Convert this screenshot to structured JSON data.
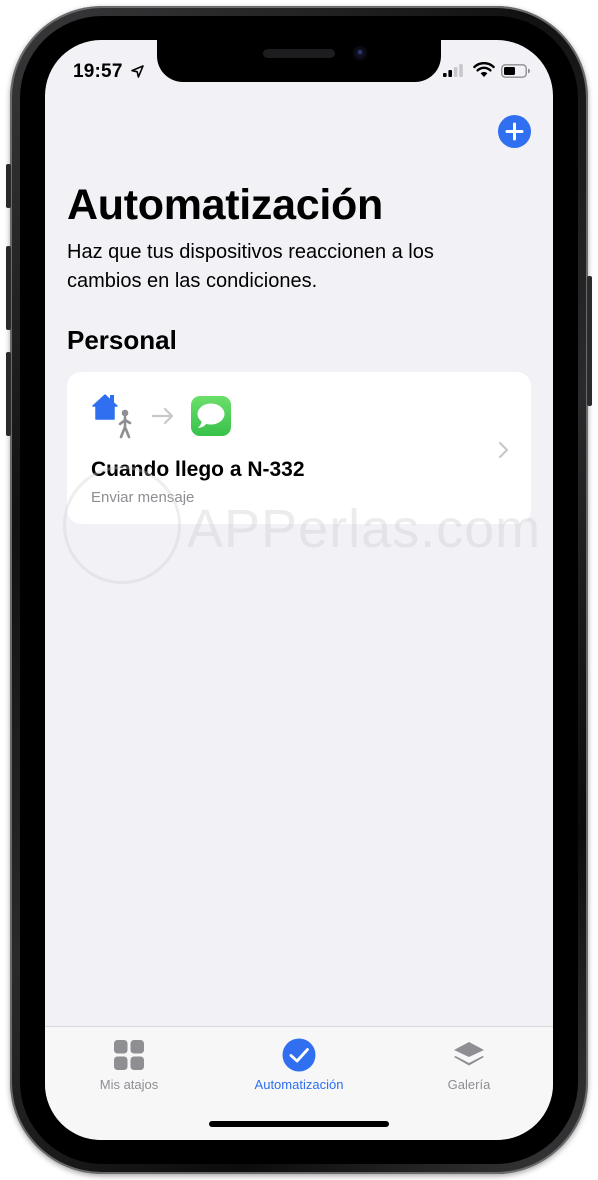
{
  "status_bar": {
    "time": "19:57"
  },
  "header": {
    "add_button_label": "+"
  },
  "page": {
    "title": "Automatización",
    "subtitle": "Haz que tus dispositivos reaccionen a los cambios en las condiciones.",
    "section_title": "Personal"
  },
  "automations": [
    {
      "title": "Cuando llego a N-332",
      "subtitle": "Enviar mensaje",
      "trigger_icon": "home-arrival-icon",
      "action_icon": "messages-icon"
    }
  ],
  "watermark": {
    "text": "APPerlas.com"
  },
  "tab_bar": {
    "tabs": [
      {
        "label": "Mis atajos",
        "icon": "grid-icon",
        "active": false
      },
      {
        "label": "Automatización",
        "icon": "checkmark-circle-icon",
        "active": true
      },
      {
        "label": "Galería",
        "icon": "layers-icon",
        "active": false
      }
    ]
  },
  "colors": {
    "accent": "#2f6ff0",
    "background": "#f1f1f6",
    "card": "#ffffff",
    "secondary_text": "#8e8e93",
    "messages_green": "#4cd964"
  }
}
